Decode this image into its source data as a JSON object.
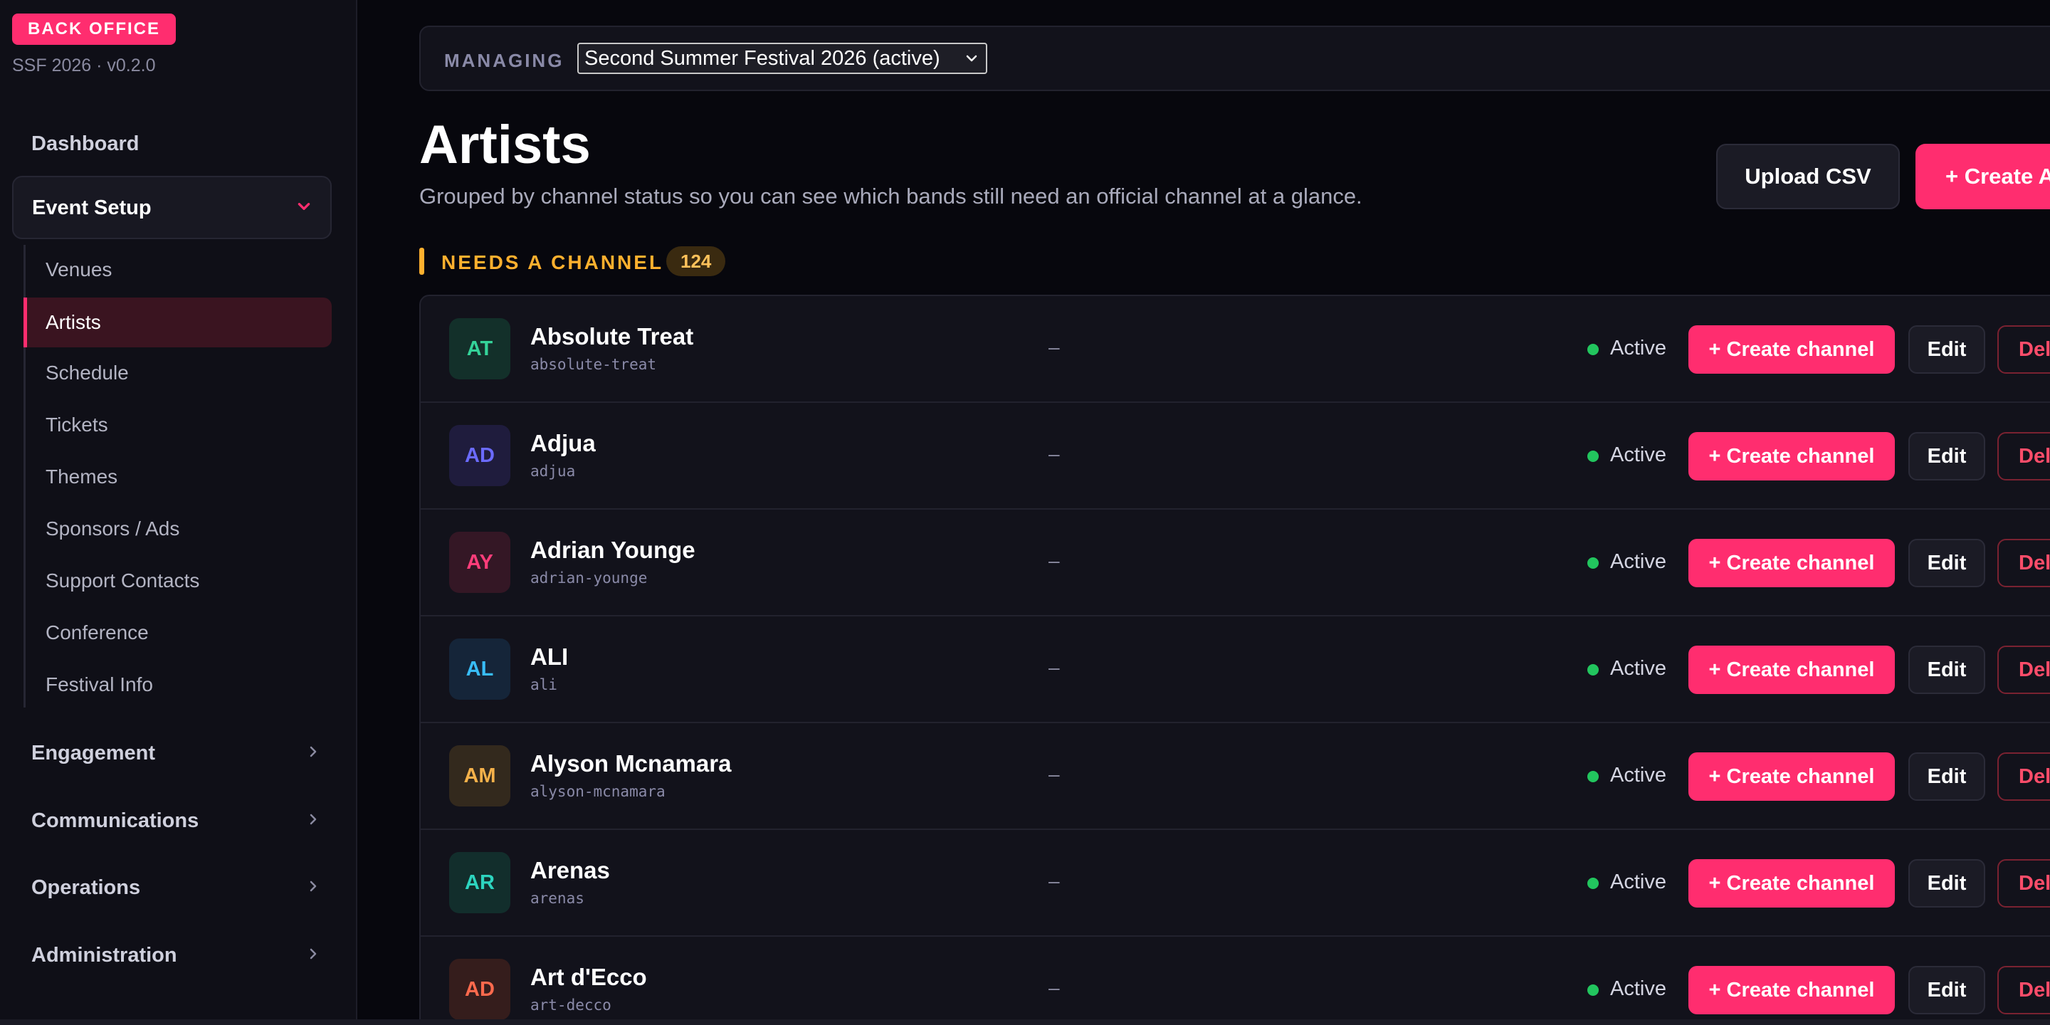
{
  "sidebar": {
    "badge": "BACK OFFICE",
    "version": "SSF 2026 · v0.2.0",
    "dashboard": "Dashboard",
    "open_group": "Event Setup",
    "subitems": [
      "Venues",
      "Artists",
      "Schedule",
      "Tickets",
      "Themes",
      "Sponsors / Ads",
      "Support Contacts",
      "Conference",
      "Festival Info"
    ],
    "active_subitem": "Artists",
    "groups": [
      "Engagement",
      "Communications",
      "Operations",
      "Administration"
    ]
  },
  "header": {
    "managing_label": "MANAGING",
    "event_selected": "Second Summer Festival 2026 (active)"
  },
  "page": {
    "title": "Artists",
    "subtitle": "Grouped by channel status so you can see which bands still need an official channel at a glance.",
    "upload_label": "Upload CSV",
    "create_label": "+ Create Artist"
  },
  "section": {
    "label": "NEEDS A CHANNEL",
    "count": "124"
  },
  "rows": [
    {
      "initials": "AT",
      "name": "Absolute Treat",
      "slug": "absolute-treat",
      "channel": "–",
      "status": "Active",
      "create": "+ Create channel",
      "edit": "Edit",
      "delete": "Delete",
      "fg": "#34d399",
      "bg": "#13302a"
    },
    {
      "initials": "AD",
      "name": "Adjua",
      "slug": "adjua",
      "channel": "–",
      "status": "Active",
      "create": "+ Create channel",
      "edit": "Edit",
      "delete": "Delete",
      "fg": "#6b6bff",
      "bg": "#1f1c3d"
    },
    {
      "initials": "AY",
      "name": "Adrian Younge",
      "slug": "adrian-younge",
      "channel": "–",
      "status": "Active",
      "create": "+ Create channel",
      "edit": "Edit",
      "delete": "Delete",
      "fg": "#ff3d7a",
      "bg": "#341725"
    },
    {
      "initials": "AL",
      "name": "ALI",
      "slug": "ali",
      "channel": "–",
      "status": "Active",
      "create": "+ Create channel",
      "edit": "Edit",
      "delete": "Delete",
      "fg": "#38bdf8",
      "bg": "#152539"
    },
    {
      "initials": "AM",
      "name": "Alyson Mcnamara",
      "slug": "alyson-mcnamara",
      "channel": "–",
      "status": "Active",
      "create": "+ Create channel",
      "edit": "Edit",
      "delete": "Delete",
      "fg": "#f5b14a",
      "bg": "#33291d"
    },
    {
      "initials": "AR",
      "name": "Arenas",
      "slug": "arenas",
      "channel": "–",
      "status": "Active",
      "create": "+ Create channel",
      "edit": "Edit",
      "delete": "Delete",
      "fg": "#2dd4bf",
      "bg": "#122e2c"
    },
    {
      "initials": "AD",
      "name": "Art d'Ecco",
      "slug": "art-decco",
      "channel": "–",
      "status": "Active",
      "create": "+ Create channel",
      "edit": "Edit",
      "delete": "Delete",
      "fg": "#ff6a4d",
      "bg": "#351d1c"
    }
  ],
  "colors": {
    "accent": "#ff2d6f",
    "warning": "#ffb02e",
    "status_active": "#22c55e"
  }
}
